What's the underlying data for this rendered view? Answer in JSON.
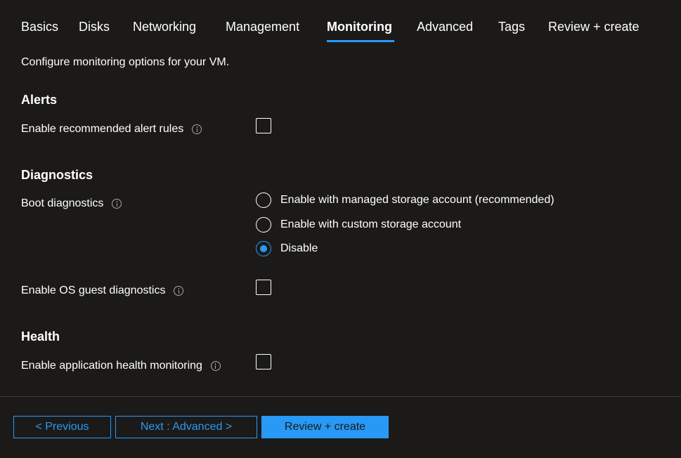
{
  "tabs": [
    {
      "label": "Basics"
    },
    {
      "label": "Disks"
    },
    {
      "label": "Networking"
    },
    {
      "label": "Management"
    },
    {
      "label": "Monitoring",
      "active": true
    },
    {
      "label": "Advanced"
    },
    {
      "label": "Tags"
    },
    {
      "label": "Review + create"
    }
  ],
  "intro": "Configure monitoring options for your VM.",
  "alerts": {
    "title": "Alerts",
    "recommended_rules": {
      "label": "Enable recommended alert rules",
      "checked": false
    }
  },
  "diagnostics": {
    "title": "Diagnostics",
    "boot": {
      "label": "Boot diagnostics",
      "options": [
        {
          "label": "Enable with managed storage account (recommended)",
          "selected": false
        },
        {
          "label": "Enable with custom storage account",
          "selected": false
        },
        {
          "label": "Disable",
          "selected": true
        }
      ]
    },
    "os_guest": {
      "label": "Enable OS guest diagnostics",
      "checked": false
    }
  },
  "health": {
    "title": "Health",
    "app_health": {
      "label": "Enable application health monitoring",
      "checked": false
    }
  },
  "footer": {
    "previous_label": "< Previous",
    "next_label": "Next : Advanced >",
    "review_label": "Review + create"
  },
  "colors": {
    "background": "#1b1a19",
    "accent": "#2899f5",
    "text": "#ffffff"
  }
}
